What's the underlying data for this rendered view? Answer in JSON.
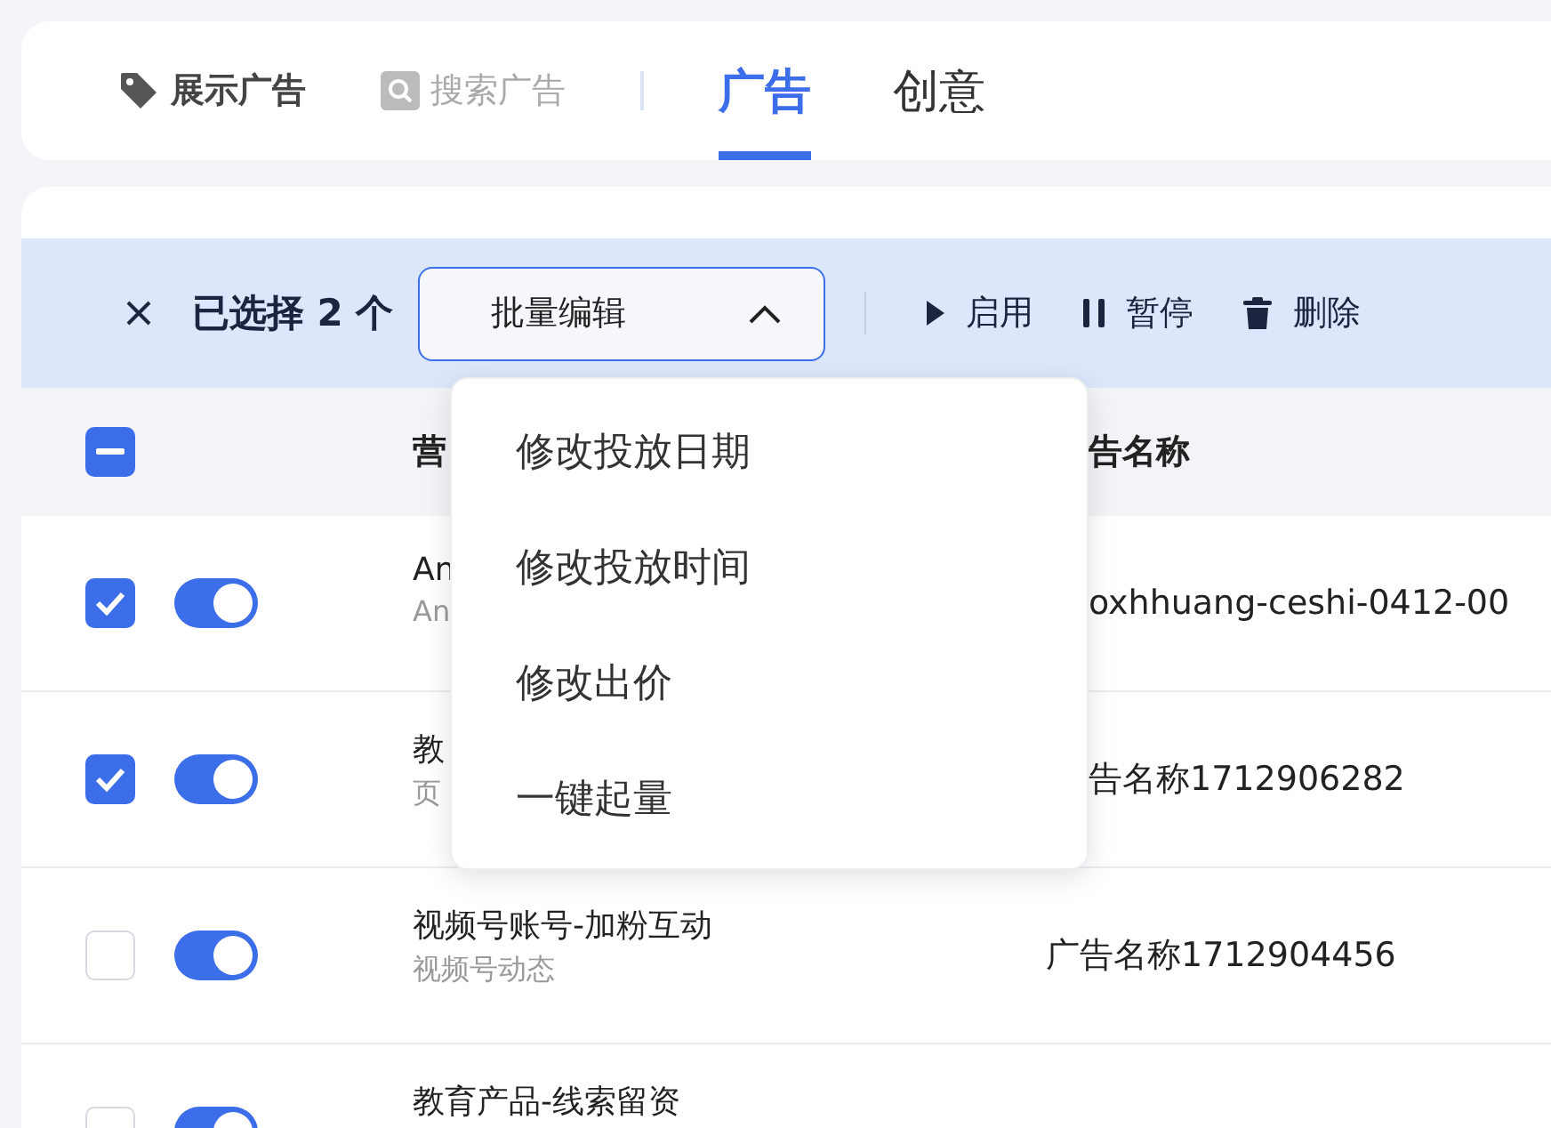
{
  "top_tabs": [
    {
      "label": "展示广告",
      "kind": "display",
      "selected": true
    },
    {
      "label": "搜索广告",
      "kind": "search",
      "selected": false
    }
  ],
  "view_tabs": [
    {
      "label": "广告",
      "selected": true
    },
    {
      "label": "创意",
      "selected": false
    }
  ],
  "selection_bar": {
    "text": "已选择 2 个",
    "dropdown": {
      "label": "批量编辑",
      "expanded": true
    },
    "actions": [
      {
        "label": "启用",
        "kind": "play"
      },
      {
        "label": "暂停",
        "kind": "pause"
      },
      {
        "label": "删除",
        "kind": "trash"
      }
    ]
  },
  "menu": [
    "修改投放日期",
    "修改投放时间",
    "修改出价",
    "一键起量"
  ],
  "table": {
    "all_indeterminate": true,
    "columns": [
      "营",
      "告名称"
    ],
    "rows": [
      {
        "checked": true,
        "on": true,
        "title": "An",
        "subtitle": "An",
        "ad_name": "oxhhuang-ceshi-0412-00",
        "cut": true
      },
      {
        "checked": true,
        "on": true,
        "title": "教",
        "subtitle": "页",
        "ad_name": "告名称1712906282",
        "cut": true
      },
      {
        "checked": false,
        "on": true,
        "title": "视频号账号-加粉互动",
        "subtitle": "视频号动态",
        "ad_name": "广告名称1712904456",
        "cut": false
      },
      {
        "checked": false,
        "on": true,
        "title": "教育产品-线索留资"
      }
    ]
  }
}
